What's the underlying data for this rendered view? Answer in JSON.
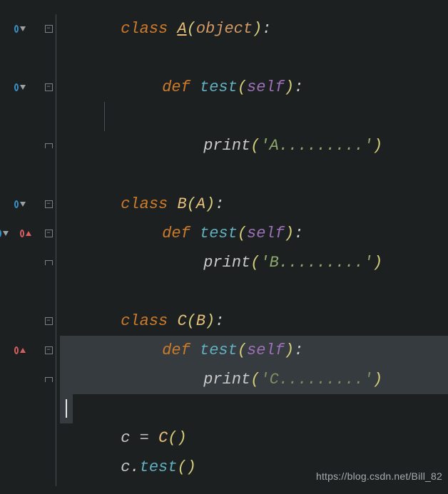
{
  "lines": {
    "l1": {
      "kw": "class ",
      "name": "A",
      "lp": "(",
      "arg": "object",
      "rp": ")",
      "colon": ":"
    },
    "l2": {
      "kw": "def ",
      "name": "test",
      "lp": "(",
      "arg": "self",
      "rp": ")",
      "colon": ":"
    },
    "l3": {
      "fn": "print",
      "lp": "(",
      "str": "'A.........'",
      "rp": ")"
    },
    "l4": {
      "kw": "class ",
      "name": "B",
      "lp": "(",
      "arg": "A",
      "rp": ")",
      "colon": ":"
    },
    "l5": {
      "kw": "def ",
      "name": "test",
      "lp": "(",
      "arg": "self",
      "rp": ")",
      "colon": ":"
    },
    "l6": {
      "fn": "print",
      "lp": "(",
      "str": "'B.........'",
      "rp": ")"
    },
    "l7": {
      "kw": "class ",
      "name": "C",
      "lp": "(",
      "arg": "B",
      "rp": ")",
      "colon": ":"
    },
    "l8": {
      "kw": "def ",
      "name": "test",
      "lp": "(",
      "arg": "self",
      "rp": ")",
      "colon": ":"
    },
    "l9": {
      "fn": "print",
      "lp": "(",
      "str": "'C.........'",
      "rp": ")"
    },
    "l10": {
      "ident": "c",
      "op": " = ",
      "call": "C",
      "lp": "(",
      "rp": ")"
    },
    "l11": {
      "ident": "c",
      "dot": ".",
      "method": "test",
      "lp": "(",
      "rp": ")"
    }
  },
  "watermark": "https://blog.csdn.net/Bill_82"
}
